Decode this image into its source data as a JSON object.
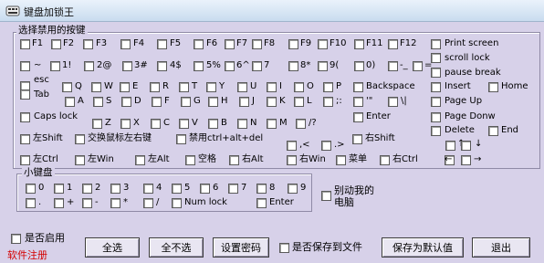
{
  "window": {
    "title": "键盘加锁王"
  },
  "main_group": {
    "label": "选择禁用的按键"
  },
  "keypad_group": {
    "label": "小键盘"
  },
  "rows": {
    "r1": [
      {
        "label": "F1",
        "cb": [
          22,
          43
        ],
        "lb": [
          35,
          42
        ]
      },
      {
        "label": "F2",
        "cb": [
          56,
          43
        ],
        "lb": [
          69,
          42
        ]
      },
      {
        "label": "F3",
        "cb": [
          91,
          43
        ],
        "lb": [
          105,
          42
        ]
      },
      {
        "label": "F4",
        "cb": [
          132,
          43
        ],
        "lb": [
          146,
          42
        ]
      },
      {
        "label": "F5",
        "cb": [
          172,
          43
        ],
        "lb": [
          186,
          42
        ]
      },
      {
        "label": "F6",
        "cb": [
          212,
          43
        ],
        "lb": [
          226,
          42
        ]
      },
      {
        "label": "F7",
        "cb": [
          246,
          43
        ],
        "lb": [
          259,
          42
        ]
      },
      {
        "label": "F8",
        "cb": [
          276,
          43
        ],
        "lb": [
          289,
          42
        ]
      },
      {
        "label": "F9",
        "cb": [
          316,
          43
        ],
        "lb": [
          329,
          42
        ]
      },
      {
        "label": "F10",
        "cb": [
          348,
          43
        ],
        "lb": [
          361,
          42
        ]
      },
      {
        "label": "F11",
        "cb": [
          388,
          43
        ],
        "lb": [
          401,
          42
        ]
      },
      {
        "label": "F12",
        "cb": [
          425,
          43
        ],
        "lb": [
          438,
          42
        ]
      },
      {
        "label": "Print screen",
        "cb": [
          472,
          43
        ],
        "lb": [
          487,
          42
        ]
      }
    ],
    "r2": [
      {
        "label": "~",
        "cb": [
          22,
          67
        ],
        "lb": [
          37,
          66
        ]
      },
      {
        "label": "1!",
        "cb": [
          55,
          67
        ],
        "lb": [
          68,
          66
        ]
      },
      {
        "label": "2@",
        "cb": [
          92,
          67
        ],
        "lb": [
          106,
          66
        ]
      },
      {
        "label": "3#",
        "cb": [
          134,
          67
        ],
        "lb": [
          147,
          66
        ]
      },
      {
        "label": "4$",
        "cb": [
          172,
          67
        ],
        "lb": [
          186,
          66
        ]
      },
      {
        "label": "5%",
        "cb": [
          212,
          67
        ],
        "lb": [
          226,
          66
        ]
      },
      {
        "label": "6^",
        "cb": [
          246,
          67
        ],
        "lb": [
          259,
          66
        ]
      },
      {
        "label": "7",
        "cb": [
          276,
          67
        ],
        "lb": [
          289,
          66
        ]
      },
      {
        "label": "8*",
        "cb": [
          316,
          67
        ],
        "lb": [
          329,
          66
        ]
      },
      {
        "label": "9(",
        "cb": [
          348,
          67
        ],
        "lb": [
          361,
          66
        ]
      },
      {
        "label": "0)",
        "cb": [
          388,
          67
        ],
        "lb": [
          401,
          66
        ]
      },
      {
        "label": "-_",
        "cb": [
          425,
          67
        ],
        "lb": [
          438,
          66
        ]
      },
      {
        "label": "=",
        "cb": [
          452,
          67
        ],
        "lb": [
          465,
          66
        ]
      },
      {
        "label": "scroll lock",
        "cb": [
          472,
          58
        ],
        "lb": [
          487,
          58
        ]
      },
      {
        "label": "pause break",
        "cb": [
          472,
          74
        ],
        "lb": [
          487,
          74
        ]
      }
    ],
    "r3": [
      {
        "label": "esc",
        "cb": [
          22,
          89
        ],
        "lb": [
          37,
          82
        ]
      },
      {
        "label": "Tab",
        "cb": [
          22,
          98
        ],
        "lb": [
          37,
          98
        ]
      },
      {
        "label": "Q",
        "cb": [
          68,
          90
        ],
        "lb": [
          82,
          89
        ]
      },
      {
        "label": "W",
        "cb": [
          100,
          90
        ],
        "lb": [
          114,
          89
        ]
      },
      {
        "label": "E",
        "cb": [
          131,
          90
        ],
        "lb": [
          145,
          89
        ]
      },
      {
        "label": "R",
        "cb": [
          164,
          90
        ],
        "lb": [
          178,
          89
        ]
      },
      {
        "label": "T",
        "cb": [
          196,
          90
        ],
        "lb": [
          210,
          89
        ]
      },
      {
        "label": "Y",
        "cb": [
          226,
          90
        ],
        "lb": [
          240,
          89
        ]
      },
      {
        "label": "U",
        "cb": [
          260,
          90
        ],
        "lb": [
          274,
          89
        ]
      },
      {
        "label": "I",
        "cb": [
          292,
          90
        ],
        "lb": [
          306,
          89
        ]
      },
      {
        "label": "O",
        "cb": [
          322,
          90
        ],
        "lb": [
          336,
          89
        ]
      },
      {
        "label": "P",
        "cb": [
          354,
          90
        ],
        "lb": [
          368,
          89
        ]
      },
      {
        "label": "Backspace",
        "cb": [
          387,
          90
        ],
        "lb": [
          401,
          89
        ]
      },
      {
        "label": "Insert",
        "cb": [
          472,
          90
        ],
        "lb": [
          487,
          89
        ]
      },
      {
        "label": "Home",
        "cb": [
          535,
          90
        ],
        "lb": [
          549,
          89
        ]
      }
    ],
    "r4": [
      {
        "label": "A",
        "cb": [
          71,
          106
        ],
        "lb": [
          85,
          105
        ]
      },
      {
        "label": "S",
        "cb": [
          102,
          106
        ],
        "lb": [
          116,
          105
        ]
      },
      {
        "label": "D",
        "cb": [
          133,
          106
        ],
        "lb": [
          147,
          105
        ]
      },
      {
        "label": "F",
        "cb": [
          166,
          106
        ],
        "lb": [
          180,
          105
        ]
      },
      {
        "label": "G",
        "cb": [
          198,
          106
        ],
        "lb": [
          212,
          105
        ]
      },
      {
        "label": "H",
        "cb": [
          228,
          106
        ],
        "lb": [
          242,
          105
        ]
      },
      {
        "label": "J",
        "cb": [
          262,
          106
        ],
        "lb": [
          276,
          105
        ]
      },
      {
        "label": "K",
        "cb": [
          292,
          106
        ],
        "lb": [
          306,
          105
        ]
      },
      {
        "label": "L",
        "cb": [
          322,
          106
        ],
        "lb": [
          336,
          105
        ]
      },
      {
        "label": ";:",
        "cb": [
          354,
          106
        ],
        "lb": [
          368,
          105
        ]
      },
      {
        "label": "'\"",
        "cb": [
          387,
          106
        ],
        "lb": [
          401,
          105
        ]
      },
      {
        "label": "\\|",
        "cb": [
          425,
          106
        ],
        "lb": [
          439,
          105
        ]
      },
      {
        "label": "Page Up",
        "cb": [
          472,
          106
        ],
        "lb": [
          487,
          105
        ]
      }
    ],
    "r5": [
      {
        "label": "Caps lock",
        "cb": [
          22,
          123
        ],
        "lb": [
          37,
          122
        ]
      },
      {
        "label": "Enter",
        "cb": [
          387,
          123
        ],
        "lb": [
          401,
          122
        ]
      },
      {
        "label": "Page Donw",
        "cb": [
          472,
          123
        ],
        "lb": [
          487,
          122
        ]
      }
    ],
    "r6": [
      {
        "label": "Z",
        "cb": [
          101,
          130
        ],
        "lb": [
          115,
          129
        ]
      },
      {
        "label": "X",
        "cb": [
          132,
          130
        ],
        "lb": [
          146,
          129
        ]
      },
      {
        "label": "C",
        "cb": [
          165,
          130
        ],
        "lb": [
          179,
          129
        ]
      },
      {
        "label": "V",
        "cb": [
          196,
          130
        ],
        "lb": [
          210,
          129
        ]
      },
      {
        "label": "B",
        "cb": [
          228,
          130
        ],
        "lb": [
          242,
          129
        ]
      },
      {
        "label": "N",
        "cb": [
          260,
          130
        ],
        "lb": [
          274,
          129
        ]
      },
      {
        "label": "M",
        "cb": [
          292,
          130
        ],
        "lb": [
          306,
          129
        ]
      },
      {
        "label": "/?",
        "cb": [
          324,
          130
        ],
        "lb": [
          338,
          129
        ]
      },
      {
        "label": "Delete",
        "cb": [
          472,
          138
        ],
        "lb": [
          487,
          137
        ]
      },
      {
        "label": "End",
        "cb": [
          535,
          138
        ],
        "lb": [
          549,
          137
        ]
      }
    ],
    "r7": [
      {
        "label": "左Shift",
        "cb": [
          22,
          147
        ],
        "lb": [
          36,
          146
        ]
      },
      {
        "label": "交换鼠标左右键",
        "cb": [
          82,
          147
        ],
        "lb": [
          96,
          146
        ]
      },
      {
        "label": "禁用ctrl+alt+del",
        "cb": [
          193,
          147
        ],
        "lb": [
          207,
          146
        ]
      },
      {
        "label": "右Shift",
        "cb": [
          386,
          147
        ],
        "lb": [
          400,
          146
        ]
      },
      {
        "label": "↑",
        "cb": [
          488,
          154
        ],
        "lb": [
          501,
          152
        ]
      },
      {
        "label": "↓",
        "cb": [
          505,
          154
        ],
        "lb": [
          520,
          152
        ]
      }
    ],
    "r8": [
      {
        "label": ",<",
        "cb": [
          314,
          154
        ],
        "lb": [
          328,
          153
        ]
      },
      {
        "label": ".>",
        "cb": [
          352,
          154
        ],
        "lb": [
          366,
          153
        ]
      },
      {
        "label": "左Ctrl",
        "cb": [
          22,
          170
        ],
        "lb": [
          36,
          169
        ]
      },
      {
        "label": "左Win",
        "cb": [
          82,
          170
        ],
        "lb": [
          96,
          169
        ]
      },
      {
        "label": "左Alt",
        "cb": [
          148,
          170
        ],
        "lb": [
          162,
          169
        ]
      },
      {
        "label": "空格",
        "cb": [
          203,
          170
        ],
        "lb": [
          217,
          169
        ]
      },
      {
        "label": "右Alt",
        "cb": [
          251,
          170
        ],
        "lb": [
          265,
          169
        ]
      },
      {
        "label": "右Win",
        "cb": [
          314,
          170
        ],
        "lb": [
          328,
          169
        ]
      },
      {
        "label": "菜单",
        "cb": [
          368,
          170
        ],
        "lb": [
          382,
          169
        ]
      },
      {
        "label": "右Ctrl",
        "cb": [
          416,
          170
        ],
        "lb": [
          430,
          169
        ]
      },
      {
        "label": "←",
        "cb": [
          487,
          170
        ],
        "lb": [
          487,
          169
        ]
      },
      {
        "label": "→",
        "cb": [
          505,
          170
        ],
        "lb": [
          519,
          169
        ]
      }
    ],
    "k1": [
      {
        "label": "0",
        "cb": [
          28,
          201
        ],
        "lb": [
          42,
          200
        ]
      },
      {
        "label": "1",
        "cb": [
          59,
          201
        ],
        "lb": [
          73,
          200
        ]
      },
      {
        "label": "2",
        "cb": [
          90,
          201
        ],
        "lb": [
          104,
          200
        ]
      },
      {
        "label": "3",
        "cb": [
          121,
          201
        ],
        "lb": [
          135,
          200
        ]
      },
      {
        "label": "4",
        "cb": [
          157,
          201
        ],
        "lb": [
          171,
          200
        ]
      },
      {
        "label": "5",
        "cb": [
          188,
          201
        ],
        "lb": [
          202,
          200
        ]
      },
      {
        "label": "6",
        "cb": [
          219,
          201
        ],
        "lb": [
          233,
          200
        ]
      },
      {
        "label": "7",
        "cb": [
          250,
          201
        ],
        "lb": [
          264,
          200
        ]
      },
      {
        "label": "8",
        "cb": [
          281,
          201
        ],
        "lb": [
          295,
          200
        ]
      },
      {
        "label": "9",
        "cb": [
          315,
          201
        ],
        "lb": [
          329,
          200
        ]
      }
    ],
    "k2": [
      {
        "label": ".",
        "cb": [
          28,
          217
        ],
        "lb": [
          42,
          216
        ]
      },
      {
        "label": "+",
        "cb": [
          59,
          217
        ],
        "lb": [
          73,
          216
        ]
      },
      {
        "label": "-",
        "cb": [
          90,
          217
        ],
        "lb": [
          104,
          216
        ]
      },
      {
        "label": "*",
        "cb": [
          121,
          217
        ],
        "lb": [
          135,
          216
        ]
      },
      {
        "label": "/",
        "cb": [
          157,
          217
        ],
        "lb": [
          171,
          216
        ]
      },
      {
        "label": "Num lock",
        "cb": [
          188,
          217
        ],
        "lb": [
          202,
          216
        ]
      },
      {
        "label": "Enter",
        "cb": [
          281,
          217
        ],
        "lb": [
          295,
          216
        ]
      }
    ]
  },
  "ime_toggle": {
    "label1": "别动我的",
    "label2": "电脑"
  },
  "bottom": {
    "enable_label": "是否启用",
    "register": "软件注册",
    "select_all": "全选",
    "select_none": "全不选",
    "set_password": "设置密码",
    "save_to_file": "是否保存到文件",
    "save_default": "保存为默认值",
    "exit": "退出"
  }
}
